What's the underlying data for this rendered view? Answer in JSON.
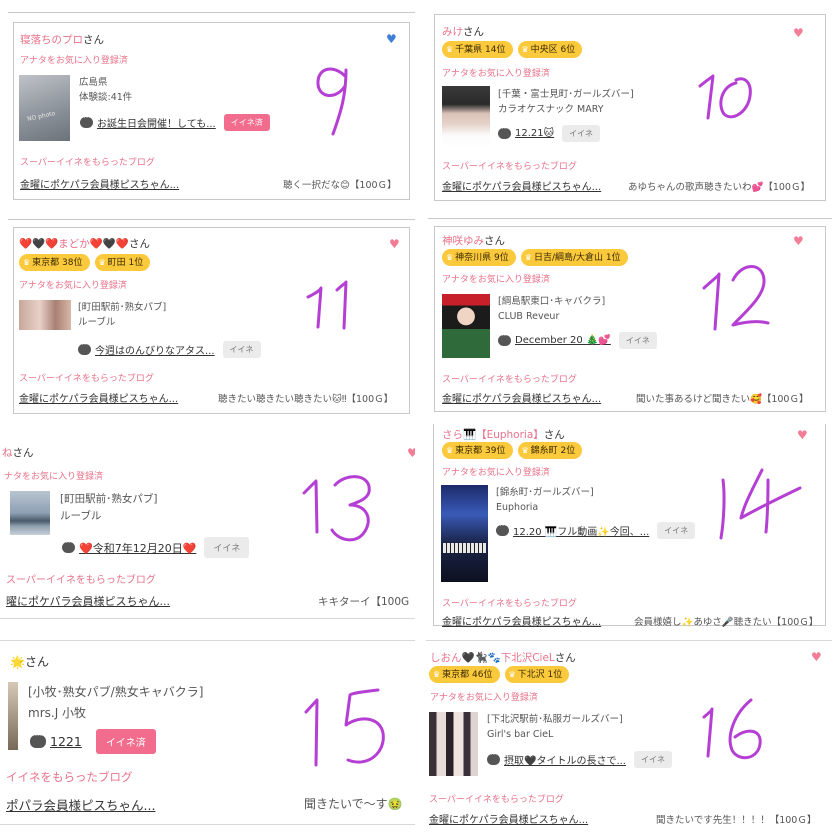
{
  "cards": {
    "c9": {
      "name": "寝落ちのプロ",
      "san": "さん",
      "fav": "アナタをお気に入り登録済",
      "pref": "広島県",
      "exp": "体験談:41件",
      "msg": "お誕生日会開催！しても...",
      "btn": "イイネ済",
      "super": "スーパーイイネをもらったブログ",
      "blog": "金曜にポケパラ会員様ピスちゃん...",
      "comment": "聴く一択だな😊【100Ｇ】",
      "thumb_text": "NO photo",
      "hw": "9"
    },
    "c10": {
      "name": "みけ",
      "san": "さん",
      "badge1": "千葉県 14位",
      "badge2": "中央区 6位",
      "fav": "アナタをお気に入り登録済",
      "shop1": "[千葉・富士見町･ガールズバー]",
      "shop2": "カラオケスナック MARY",
      "msg": "12.21🐱",
      "btn": "イイネ",
      "super": "スーパーイイネをもらったブログ",
      "blog": "金曜にポケパラ会員様ピスちゃん...",
      "comment": "あゆちゃんの歌声聴きたいわ💕【100Ｇ】",
      "hw": "10"
    },
    "c11": {
      "name": "❤️🖤❤️まどか❤️🖤❤️",
      "san": "さん",
      "badge1": "東京都 38位",
      "badge2": "町田 1位",
      "fav": "アナタをお気に入り登録済",
      "shop1": "[町田駅前･熟女パブ]",
      "shop2": "ルーブル",
      "msg": "今週はのんびりなアタス...",
      "btn": "イイネ",
      "super": "スーパーイイネをもらったブログ",
      "blog": "金曜にポケパラ会員様ピスちゃん...",
      "comment": "聴きたい聴きたい聴きたい🐱‼【100Ｇ】",
      "hw": "11"
    },
    "c12": {
      "name": "神咲ゆみ",
      "san": "さん",
      "badge1": "神奈川県 9位",
      "badge2": "日吉/綱島/大倉山 1位",
      "fav": "アナタをお気に入り登録済",
      "shop1": "[綱島駅東口･キャバクラ]",
      "shop2": "CLUB Reveur",
      "msg": "December 20 🎄💕",
      "btn": "イイネ",
      "super": "スーパーイイネをもらったブログ",
      "blog": "金曜にポケパラ会員様ピスちゃん...",
      "comment": "聞いた事あるけど聞きたい🥰【100Ｇ】",
      "hw": "12"
    },
    "c13": {
      "name": "ね",
      "san": "さん",
      "fav": "ナタをお気に入り登録済",
      "shop1": "[町田駅前･熟女パブ]",
      "shop2": "ルーブル",
      "msg": "❤️令和7年12月20日❤️",
      "btn": "イイネ",
      "super": "スーパーイイネをもらったブログ",
      "blog": "曜にポケパラ会員様ピスちゃん...",
      "comment": "キキターイ【100G",
      "hw": "13"
    },
    "c14": {
      "name": "さら🎹【Euphoria】",
      "san": "さん",
      "badge1": "東京都 39位",
      "badge2": "錦糸町 2位",
      "fav": "アナタをお気に入り登録済",
      "shop1": "[錦糸町･ガールズバー]",
      "shop2": "Euphoria",
      "msg": "12.20 🎹フル動画✨今回、...",
      "btn": "イイネ",
      "super": "スーパーイイネをもらったブログ",
      "blog": "金曜にポケパラ会員様ピスちゃん...",
      "comment": "会員様嬉し✨あゆさ🎤聴きたい【100Ｇ】",
      "hw": "14"
    },
    "c15": {
      "name": "🌟",
      "san": "さん",
      "shop1": "[小牧･熟女パブ/熟女キャバクラ]",
      "shop2": "mrs.J 小牧",
      "msg": "1221",
      "btn": "イイネ済",
      "super": "イイネをもらったブログ",
      "blog": "ポパラ会員様ピスちゃん...",
      "comment": "聞きたいで〜す🤢",
      "hw": "15"
    },
    "c16": {
      "name": "しおん🖤🐈‍⬛🐾下北沢CieL",
      "san": "さん",
      "badge1": "東京都 46位",
      "badge2": "下北沢 1位",
      "fav": "アナタをお気に入り登録済",
      "shop1": "[下北沢駅前･私服ガールズバー]",
      "shop2": "Girl's bar CieL",
      "msg": "摂取🖤タイトルの長さで...",
      "btn": "イイネ",
      "super": "スーパーイイネをもらったブログ",
      "blog": "金曜にポケパラ会員様ピスちゃん...",
      "comment": "聞きたいです先生！！！！【100Ｇ】",
      "hw": "16"
    }
  },
  "colors": {
    "pink": "#e8728a",
    "badge": "#fbc93c",
    "heart_pink": "#f27c95",
    "heart_blue": "#3f7fd6",
    "handwriting": "#b53fd4",
    "button_done": "#f26c8d"
  },
  "icons": {
    "heart": "heart-icon",
    "crown": "crown-icon",
    "chat": "chat-bubble-icon"
  }
}
